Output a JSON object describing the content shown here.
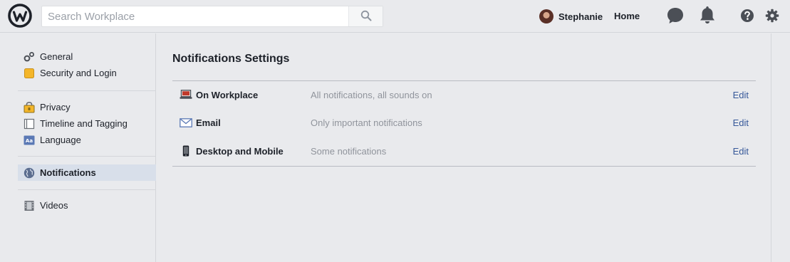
{
  "header": {
    "logo_icon": "workplace-logo-icon",
    "search": {
      "placeholder": "Search Workplace",
      "value": "",
      "icon": "search-icon"
    },
    "user": {
      "name": "Stephanie"
    },
    "home_label": "Home",
    "icons": [
      "chat-icon",
      "notifications-bell-icon",
      "help-icon",
      "gear-icon"
    ]
  },
  "sidebar": {
    "groups": [
      {
        "items": [
          {
            "label": "General",
            "icon": "gears-icon"
          },
          {
            "label": "Security and Login",
            "icon": "lock-badge-icon"
          }
        ]
      },
      {
        "items": [
          {
            "label": "Privacy",
            "icon": "privacy-lock-icon"
          },
          {
            "label": "Timeline and Tagging",
            "icon": "timeline-icon"
          },
          {
            "label": "Language",
            "icon": "language-icon"
          }
        ]
      },
      {
        "items": [
          {
            "label": "Notifications",
            "icon": "globe-icon",
            "active": true
          }
        ]
      },
      {
        "items": [
          {
            "label": "Videos",
            "icon": "film-icon"
          }
        ]
      }
    ]
  },
  "main": {
    "title": "Notifications Settings",
    "rows": [
      {
        "title": "On Workplace",
        "summary": "All notifications, all sounds on",
        "action": "Edit",
        "icon": "laptop-icon"
      },
      {
        "title": "Email",
        "summary": "Only important notifications",
        "action": "Edit",
        "icon": "envelope-icon"
      },
      {
        "title": "Desktop and Mobile",
        "summary": "Some notifications",
        "action": "Edit",
        "icon": "mobile-phone-icon"
      }
    ]
  },
  "colors": {
    "background": "#e9eaed",
    "link": "#365899",
    "active_nav": "#d8dfea",
    "muted_text": "#90949c",
    "icon_dark": "#4b4f56"
  }
}
